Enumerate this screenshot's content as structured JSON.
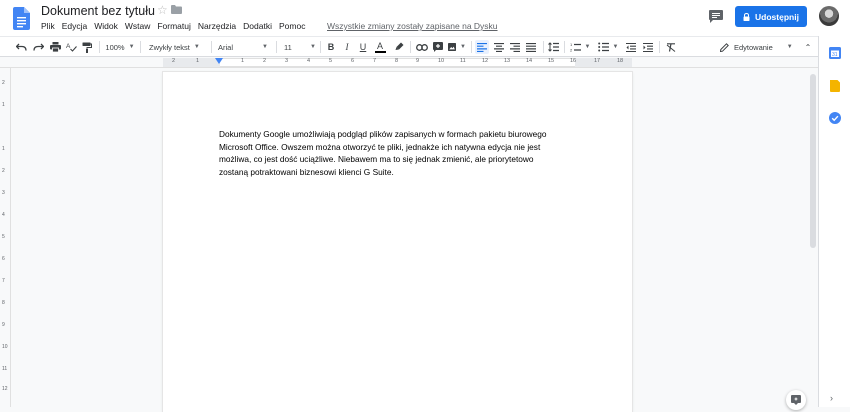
{
  "app": {
    "doc_title": "Dokument bez tytułu",
    "saved_status": "Wszystkie zmiany zostały zapisane na Dysku",
    "share_label": "Udostępnij"
  },
  "menu": [
    "Plik",
    "Edycja",
    "Widok",
    "Wstaw",
    "Formatuj",
    "Narzędzia",
    "Dodatki",
    "Pomoc"
  ],
  "toolbar": {
    "zoom": "100%",
    "style": "Zwykły tekst",
    "font": "Arial",
    "font_size": "11",
    "mode": "Edytowanie"
  },
  "ruler": {
    "numbers": [
      "2",
      "1",
      "1",
      "2",
      "3",
      "4",
      "5",
      "6",
      "7",
      "8",
      "9",
      "10",
      "11",
      "12",
      "13",
      "14",
      "15",
      "16",
      "17",
      "18"
    ]
  },
  "vruler": {
    "numbers": [
      "2",
      "1",
      "1",
      "2",
      "3",
      "4",
      "5",
      "6",
      "7",
      "8",
      "9",
      "10",
      "11",
      "12",
      "13",
      "14",
      "15"
    ]
  },
  "document": {
    "lines": [
      "Dokumenty Google umożliwiają podgląd plików zapisanych w formach pakietu biurowego",
      "Microsoft Office. Owszem można otworzyć te pliki, jednakże ich natywna edycja nie jest",
      "możliwa, co jest dość uciążliwe. Niebawem ma to się jednak zmienić, ale priorytetowo",
      "zostaną potraktowani biznesowi klienci G Suite."
    ]
  },
  "colors": {
    "accent": "#1a73e8",
    "doc_logo": "#4285f4",
    "keep": "#f4b400",
    "tasks": "#4285f4"
  }
}
